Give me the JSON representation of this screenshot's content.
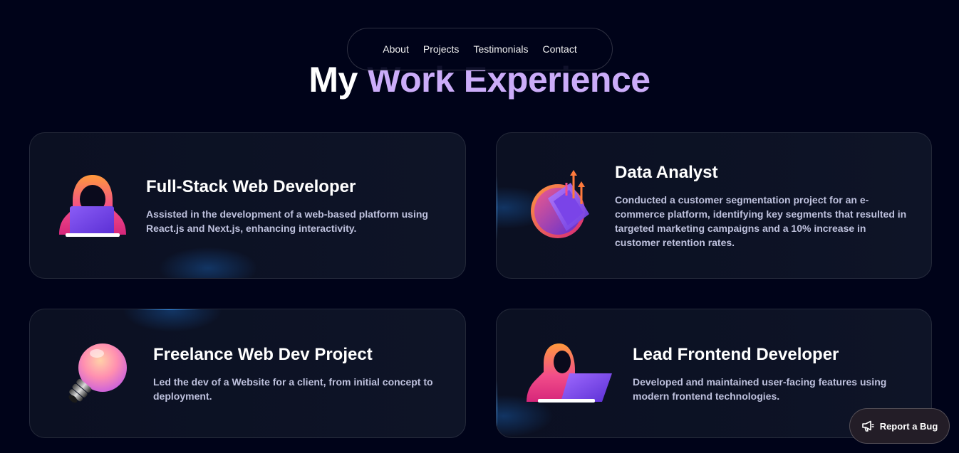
{
  "nav": {
    "items": [
      "About",
      "Projects",
      "Testimonials",
      "Contact"
    ]
  },
  "heading": {
    "prefix": "My",
    "accent": "Work Experience"
  },
  "experience": [
    {
      "title": "Full-Stack Web Developer",
      "description": "Assisted in the development of a web-based platform using React.js and Next.js, enhancing interactivity.",
      "icon": "hooded-developer-laptop-icon"
    },
    {
      "title": "Data Analyst",
      "description": "Conducted a customer segmentation project for an e-commerce platform, identifying key segments that resulted in targeted marketing campaigns and a 10% increase in customer retention rates.",
      "icon": "analytics-chart-icon"
    },
    {
      "title": "Freelance Web Dev Project",
      "description": "Led the dev of a Website for a client, from initial concept to deployment.",
      "icon": "light-bulb-icon"
    },
    {
      "title": "Lead Frontend Developer",
      "description": "Developed and maintained user-facing features using modern frontend technologies.",
      "icon": "developer-laptop-icon"
    }
  ],
  "report_bug": {
    "label": "Report a Bug",
    "icon": "megaphone-icon"
  },
  "colors": {
    "background": "#000319",
    "accent": "#cbacf9",
    "card": "#0d1326",
    "muted_text": "#bec1dd"
  }
}
